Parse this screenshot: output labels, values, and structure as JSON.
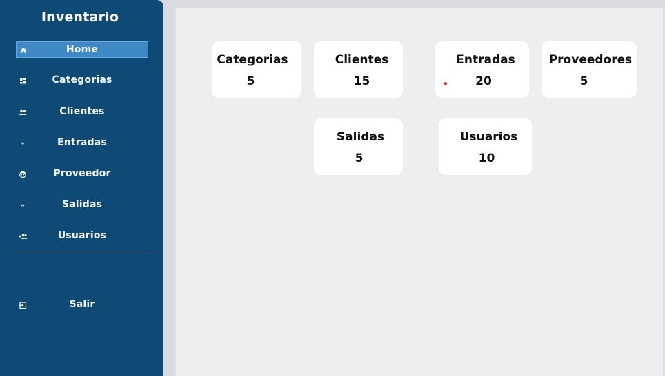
{
  "sidebar": {
    "brand": "Inventario",
    "items": [
      {
        "label": "Home",
        "icon": "home-icon"
      },
      {
        "label": "Categorias",
        "icon": "dashboard-icon"
      },
      {
        "label": "Clientes",
        "icon": "people-icon"
      },
      {
        "label": "Entradas",
        "icon": "chevron-down-icon"
      },
      {
        "label": "Proveedor",
        "icon": "face-icon"
      },
      {
        "label": "Salidas",
        "icon": "chevron-up-icon"
      },
      {
        "label": "Usuarios",
        "icon": "group-add-icon"
      },
      {
        "label": "Salir",
        "icon": "logout-icon"
      }
    ],
    "colors": {
      "background": "#0e4a75",
      "active": "#3f8ac6"
    }
  },
  "cards": [
    {
      "title": "Categorias",
      "value": "5"
    },
    {
      "title": "Clientes",
      "value": "15"
    },
    {
      "title": "Entradas",
      "value": "20"
    },
    {
      "title": "Proveedores",
      "value": "5"
    },
    {
      "title": "Salidas",
      "value": "5"
    },
    {
      "title": "Usuarios",
      "value": "10"
    }
  ]
}
